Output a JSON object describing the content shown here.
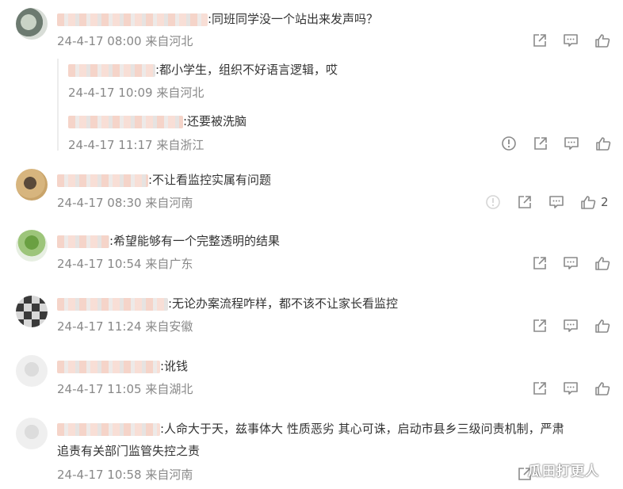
{
  "comments": [
    {
      "text": ":同班同学没一个站出来发声吗？",
      "time": "24-4-17 08:00",
      "location": "来自河北"
    },
    {
      "text": ":不让看监控实属有问题",
      "time": "24-4-17 08:30",
      "location": "来自河南",
      "likes": "2"
    },
    {
      "text": ":希望能够有一个完整透明的结果",
      "time": "24-4-17 10:54",
      "location": "来自广东"
    },
    {
      "text": ":无论办案流程咋样，都不该不让家长看监控",
      "time": "24-4-17 11:24",
      "location": "来自安徽"
    },
    {
      "text": ":讹钱",
      "time": "24-4-17 11:05",
      "location": "来自湖北"
    },
    {
      "text": ":人命大于天，兹事体大 性质恶劣 其心可诛，启动市县乡三级问责机制，严肃",
      "text2": "追责有关部门监管失控之责",
      "time": "24-4-17 10:58",
      "location": "来自河南"
    }
  ],
  "replies": [
    {
      "text": ":都小学生，组织不好语言逻辑，哎",
      "time": "24-4-17 10:09",
      "location": "来自河北"
    },
    {
      "text": ":还要被洗脑",
      "time": "24-4-17 11:17",
      "location": "来自浙江"
    }
  ],
  "icons": {
    "share": "share-icon",
    "comment": "comment-icon",
    "like": "thumbs-up-icon",
    "report": "report-icon"
  },
  "watermark": "瓜田打更人"
}
